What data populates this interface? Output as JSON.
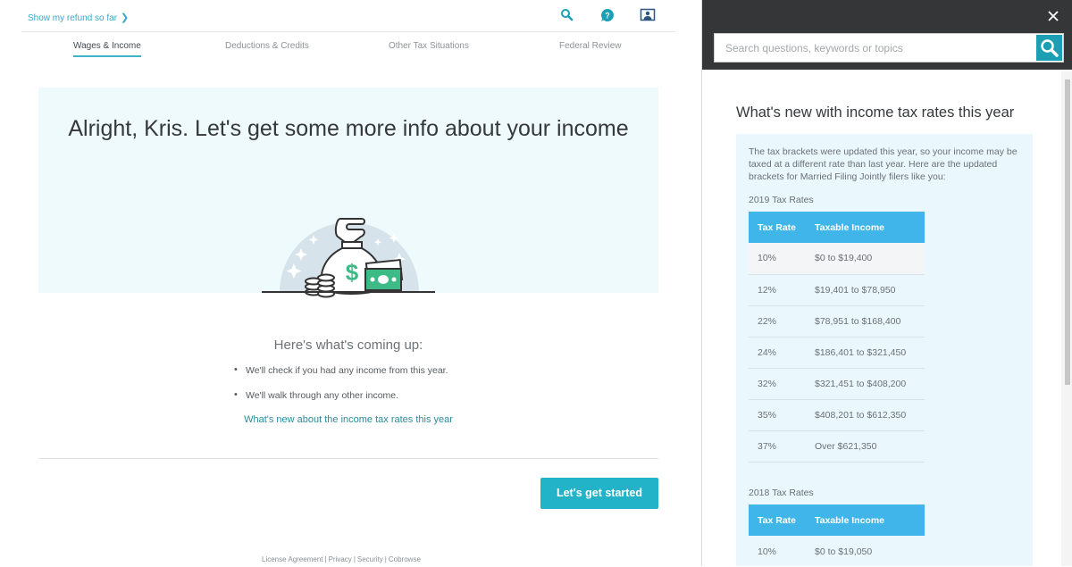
{
  "header": {
    "refund_link": "Show my refund so far",
    "icons": [
      "search-icon",
      "help-icon",
      "screen-share-icon"
    ]
  },
  "tabs": [
    {
      "label": "Wages & Income",
      "active": true
    },
    {
      "label": "Deductions & Credits",
      "active": false
    },
    {
      "label": "Other Tax Situations",
      "active": false
    },
    {
      "label": "Federal Review",
      "active": false
    }
  ],
  "hero": {
    "title": "Alright, Kris. Let's get some more info about your income",
    "illustration": "money-bag-icon"
  },
  "coming_up": {
    "heading": "Here's what's coming up:",
    "bullets": [
      "We'll check if you had any income from this year.",
      "We'll walk through any other income."
    ],
    "link": "What's new about the income tax rates this year"
  },
  "actions": {
    "start_label": "Let's get started"
  },
  "footer": {
    "links": [
      "License Agreement",
      "Privacy",
      "Security",
      "Cobrowse"
    ]
  },
  "help_panel": {
    "search_placeholder": "Search questions, keywords or topics",
    "search_value": "",
    "title": "What's new with income tax rates this year",
    "intro": "The tax brackets were updated this year, so your income may be taxed at a different rate than last year. Here are the updated brackets for Married Filing Jointly filers like you:",
    "tables": [
      {
        "label": "2019 Tax Rates",
        "columns": [
          "Tax Rate",
          "Taxable Income"
        ],
        "rows": [
          [
            "10%",
            "$0 to $19,400"
          ],
          [
            "12%",
            "$19,401 to $78,950"
          ],
          [
            "22%",
            "$78,951 to $168,400"
          ],
          [
            "24%",
            "$186,401 to $321,450"
          ],
          [
            "32%",
            "$321,451 to $408,200"
          ],
          [
            "35%",
            "$408,201 to $612,350"
          ],
          [
            "37%",
            "Over $621,350"
          ]
        ]
      },
      {
        "label": "2018 Tax Rates",
        "columns": [
          "Tax Rate",
          "Taxable Income"
        ],
        "rows": [
          [
            "10%",
            "$0 to $19,050"
          ]
        ]
      }
    ]
  },
  "colors": {
    "accent": "#23b3c8",
    "link": "#2a8c9c",
    "table_header": "#40b5ea",
    "panel_header": "#343638",
    "hero_bg": "#effafc"
  }
}
